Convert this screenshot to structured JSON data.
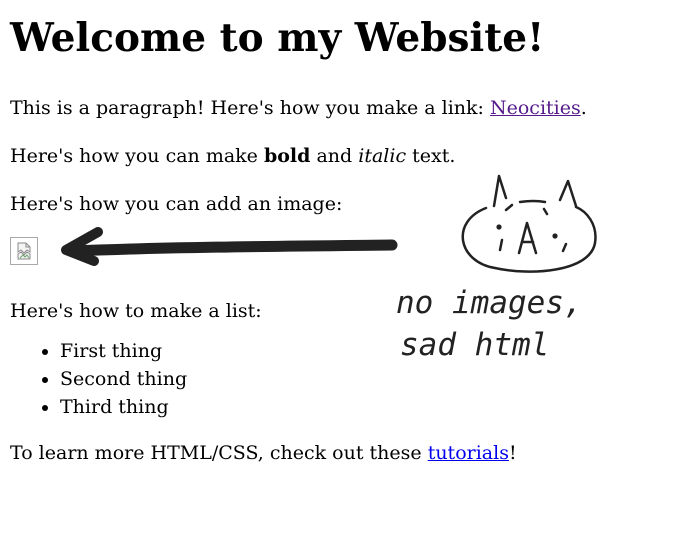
{
  "heading": "Welcome to my Website!",
  "paragraph_link": {
    "text": "This is a paragraph! Here's how you make a link: ",
    "link_label": "Neocities",
    "suffix": "."
  },
  "paragraph_format": {
    "prefix": "Here's how you can make ",
    "bold": "bold",
    "middle": " and ",
    "italic": "italic",
    "suffix": " text."
  },
  "paragraph_image": {
    "text": "Here's how you can add an image:",
    "image_icon": "broken-image-icon"
  },
  "list_section": {
    "text": "Here's how to make a list:",
    "items": [
      "First thing",
      "Second thing",
      "Third thing"
    ]
  },
  "paragraph_learn": {
    "prefix": "To learn more HTML/CSS, check out these ",
    "link_label": "tutorials",
    "suffix": "!"
  },
  "doodle": {
    "caption_line1": "no images,",
    "caption_line2": "sad html",
    "arrow_icon": "left-arrow-icon",
    "face_icon": "cat-face-icon",
    "face_text": "A"
  },
  "colors": {
    "visited_link": "#551a8b",
    "link": "#0000ee",
    "doodle_ink": "#222222"
  }
}
